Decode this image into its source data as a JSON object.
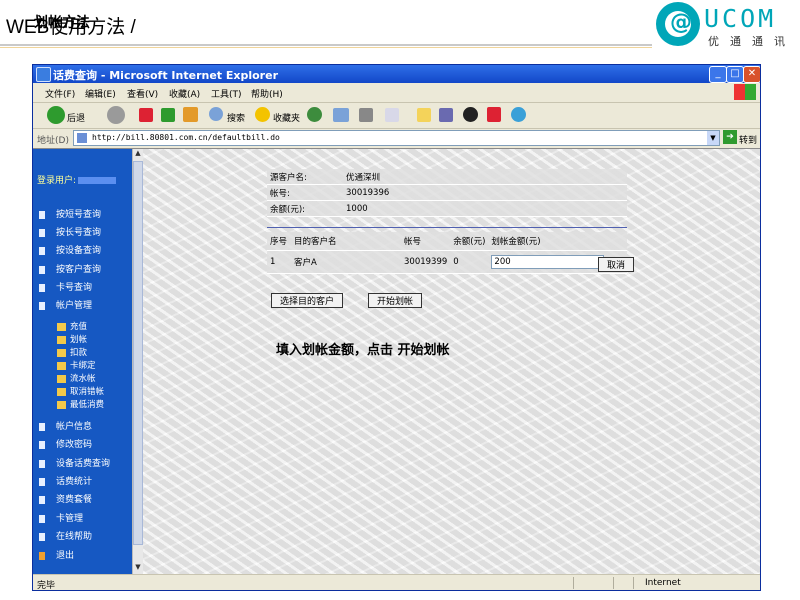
{
  "slide": {
    "title": "WEB使用方法 /",
    "subtitle": "划帐方法"
  },
  "logo": {
    "brand": "UCOM",
    "cn": "优通通讯"
  },
  "window": {
    "title": "话费查询 - Microsoft Internet Explorer"
  },
  "menu": [
    "文件(F)",
    "编辑(E)",
    "查看(V)",
    "收藏(A)",
    "工具(T)",
    "帮助(H)"
  ],
  "toolbar": {
    "back": "后退",
    "search": "搜索",
    "favorites": "收藏夹"
  },
  "address": {
    "label": "地址(D)",
    "url": "http://bill.80801.com.cn/defaultbill.do",
    "go": "转到"
  },
  "sidebar": {
    "login_label": "登录用户:",
    "items": [
      "按短号查询",
      "按长号查询",
      "按设备查询",
      "按客户查询",
      "卡号查询",
      "帐户管理"
    ],
    "subitems": [
      "充值",
      "划帐",
      "扣款",
      "卡绑定",
      "流水帐",
      "取消错帐",
      "最低消费"
    ],
    "items2": [
      "帐户信息",
      "修改密码",
      "设备话费查询",
      "话费统计",
      "资费套餐",
      "卡管理",
      "在线帮助",
      "退出"
    ]
  },
  "source": {
    "rows": [
      {
        "label": "源客户名:",
        "value": "优通深圳"
      },
      {
        "label": "帐号:",
        "value": "30019396"
      },
      {
        "label": "余额(元):",
        "value": "1000"
      }
    ]
  },
  "transfer": {
    "headers": [
      "序号",
      "目的客户名",
      "帐号",
      "余额(元)",
      "划帐金额(元)"
    ],
    "row": {
      "index": "1",
      "name": "客户A",
      "account": "30019399",
      "balance": "0",
      "amount": "200"
    },
    "cancel": "取消"
  },
  "buttons": {
    "select": "选择目的客户",
    "start": "开始划帐"
  },
  "instruction": "填入划帐金额，点击 开始划帐",
  "status": {
    "left": "完毕",
    "right": "Internet"
  }
}
